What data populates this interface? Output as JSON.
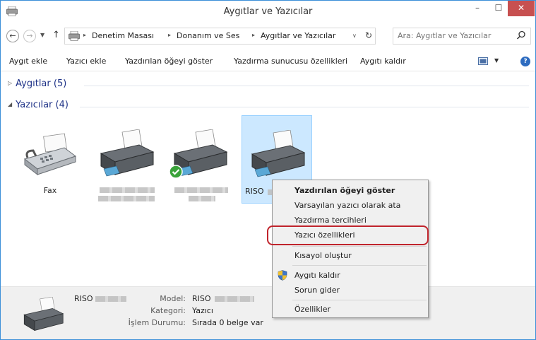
{
  "window": {
    "title": "Aygıtlar ve Yazıcılar",
    "min": "–",
    "max": "☐",
    "close": "✕"
  },
  "address": {
    "back": "←",
    "forward": "→",
    "recent": "▼",
    "up": "↑",
    "sep": "▸",
    "crumbs": [
      "Denetim Masası",
      "Donanım ve Ses",
      "Aygıtlar ve Yazıcılar"
    ],
    "dropdown": "∨",
    "refresh": "↻",
    "search_placeholder": "Ara: Aygıtlar ve Yazıcılar"
  },
  "toolbar": {
    "add_device": "Aygıt ekle",
    "add_printer": "Yazıcı ekle",
    "see_printing": "Yazdırılan öğeyi göster",
    "print_server": "Yazdırma sunucusu özellikleri",
    "remove_device": "Aygıtı kaldır",
    "view_drop": "▼",
    "help": "?"
  },
  "groups": {
    "devices": {
      "arrow": "▷",
      "label": "Aygıtlar (5)"
    },
    "printers": {
      "arrow": "◢",
      "label": "Yazıcılar (4)"
    }
  },
  "printers": [
    {
      "label": "Fax",
      "icon": "fax-icon",
      "redacted": false
    },
    {
      "label": "",
      "icon": "printer-icon",
      "redacted": true
    },
    {
      "label": "",
      "icon": "printer-icon",
      "redacted": true,
      "default": true
    },
    {
      "label": "RISO",
      "icon": "printer-icon",
      "redacted": true,
      "selected": true
    }
  ],
  "details": {
    "name": "RISO",
    "model_key": "Model:",
    "model_val": "RISO",
    "category_key": "Kategori:",
    "category_val": "Yazıcı",
    "status_key": "İşlem Durumu:",
    "status_val": "Sırada 0 belge var"
  },
  "context_menu": {
    "see_printing": "Yazdırılan öğeyi göster",
    "set_default": "Varsayılan yazıcı olarak ata",
    "preferences": "Yazdırma tercihleri",
    "printer_properties": "Yazıcı özellikleri",
    "create_shortcut": "Kısayol oluştur",
    "remove_device": "Aygıtı kaldır",
    "troubleshoot": "Sorun gider",
    "properties": "Özellikler"
  },
  "colors": {
    "accent": "#3c8fd8",
    "selection": "#cce8ff",
    "highlight_ring": "#c0242c",
    "group_header": "#1e3287",
    "close_button": "#c75050"
  }
}
